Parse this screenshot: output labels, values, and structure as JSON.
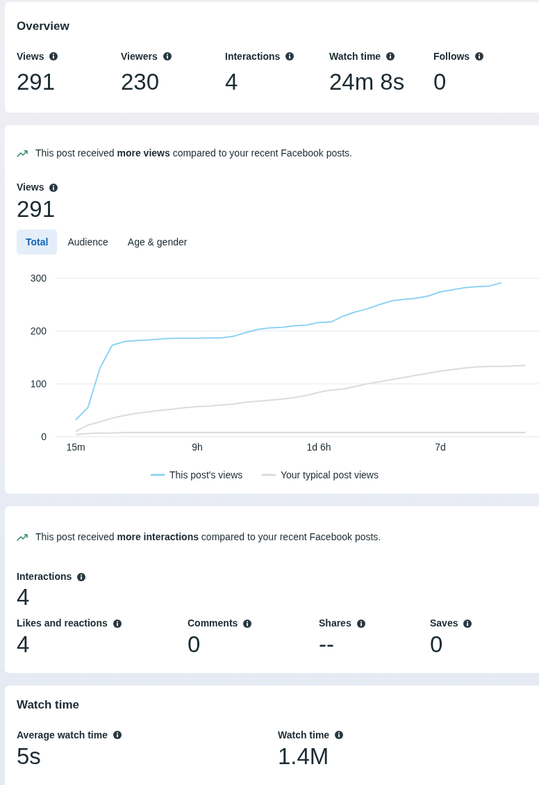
{
  "overview": {
    "title": "Overview",
    "metrics": [
      {
        "label": "Views",
        "value": "291"
      },
      {
        "label": "Viewers",
        "value": "230"
      },
      {
        "label": "Interactions",
        "value": "4"
      },
      {
        "label": "Watch time",
        "value": "24m 8s"
      },
      {
        "label": "Follows",
        "value": "0"
      }
    ]
  },
  "views": {
    "insight": "This post received **more views** compared to your recent Facebook posts.",
    "label": "Views",
    "value": "291",
    "tabs": [
      {
        "label": "Total",
        "selected": true
      },
      {
        "label": "Audience",
        "selected": false
      },
      {
        "label": "Age & gender",
        "selected": false
      }
    ],
    "chart_data": {
      "type": "line",
      "categories": [
        "15m",
        null,
        null,
        null,
        null,
        null,
        null,
        null,
        null,
        null,
        "9h",
        null,
        null,
        null,
        null,
        null,
        null,
        null,
        null,
        null,
        "1d 6h",
        null,
        null,
        null,
        null,
        null,
        null,
        null,
        null,
        null,
        "7d",
        null,
        null,
        null,
        null,
        null,
        null,
        null
      ],
      "yticks": [
        0,
        100,
        200,
        300
      ],
      "ylim": [
        0,
        300
      ],
      "legend": "bottom",
      "series": [
        {
          "name": "This post's views",
          "color": "#8fd3f4",
          "values": [
            32,
            55,
            130,
            173,
            180,
            182,
            183,
            185,
            186,
            186,
            186,
            187,
            187,
            190,
            197,
            203,
            206,
            207,
            210,
            211,
            216,
            217,
            228,
            236,
            242,
            250,
            257,
            260,
            262,
            266,
            274,
            278,
            282,
            284,
            285,
            291,
            null,
            null
          ]
        },
        {
          "name": "Your typical post views",
          "color": "#dcdcdc",
          "values": [
            10,
            22,
            28,
            35,
            40,
            44,
            47,
            50,
            52,
            55,
            57,
            58,
            60,
            62,
            65,
            67,
            69,
            71,
            74,
            78,
            84,
            88,
            90,
            95,
            100,
            104,
            108,
            112,
            116,
            120,
            124,
            127,
            130,
            132,
            133,
            133,
            134,
            135
          ]
        },
        {
          "name": null,
          "color": "#dcdcdc",
          "values": [
            4,
            6,
            7,
            7,
            8,
            8,
            8,
            8,
            8,
            8,
            8,
            8,
            8,
            8,
            8,
            8,
            8,
            8,
            8,
            8,
            8,
            8,
            8,
            8,
            8,
            8,
            8,
            8,
            8,
            8,
            8,
            8,
            8,
            8,
            8,
            8,
            8,
            8
          ]
        }
      ]
    }
  },
  "interactions": {
    "insight": "This post received **more interactions** compared to your recent Facebook posts.",
    "label": "Interactions",
    "value": "4",
    "metrics": [
      {
        "label": "Likes and reactions",
        "value": "4"
      },
      {
        "label": "Comments",
        "value": "0"
      },
      {
        "label": "Shares",
        "value": "--"
      },
      {
        "label": "Saves",
        "value": "0"
      }
    ]
  },
  "watch_time": {
    "title": "Watch time",
    "metrics": [
      {
        "label": "Average watch time",
        "value": "5s"
      },
      {
        "label": "Watch time",
        "value": "1.4M"
      }
    ]
  }
}
